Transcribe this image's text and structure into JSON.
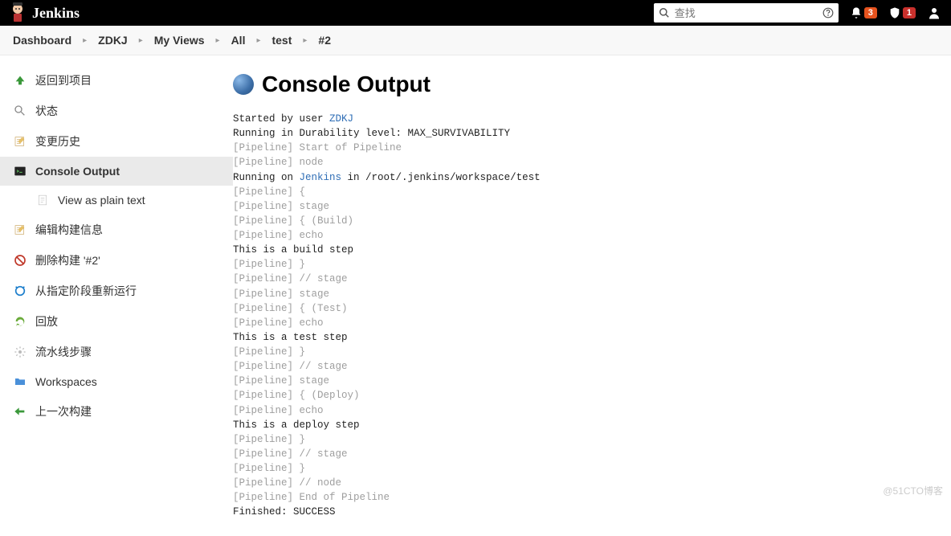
{
  "header": {
    "brand": "Jenkins",
    "search_placeholder": "查找",
    "badge_bell": "3",
    "badge_shield": "1"
  },
  "breadcrumb": [
    "Dashboard",
    "ZDKJ",
    "My Views",
    "All",
    "test",
    "#2"
  ],
  "sidebar": {
    "items": [
      {
        "label": "返回到项目"
      },
      {
        "label": "状态"
      },
      {
        "label": "变更历史"
      },
      {
        "label": "Console Output"
      },
      {
        "label": "View as plain text"
      },
      {
        "label": "编辑构建信息"
      },
      {
        "label": "删除构建 '#2'"
      },
      {
        "label": "从指定阶段重新运行"
      },
      {
        "label": "回放"
      },
      {
        "label": "流水线步骤"
      },
      {
        "label": "Workspaces"
      },
      {
        "label": "上一次构建"
      }
    ]
  },
  "page": {
    "title": "Console Output"
  },
  "console": {
    "lines": [
      {
        "cls": "txt",
        "pre": "Started by user ",
        "link": "ZDKJ",
        "post": ""
      },
      {
        "cls": "txt",
        "text": "Running in Durability level: MAX_SURVIVABILITY"
      },
      {
        "cls": "dim",
        "text": "[Pipeline] Start of Pipeline"
      },
      {
        "cls": "dim",
        "text": "[Pipeline] node"
      },
      {
        "cls": "txt",
        "pre": "Running on ",
        "link": "Jenkins",
        "post": " in /root/.jenkins/workspace/test"
      },
      {
        "cls": "dim",
        "text": "[Pipeline] {"
      },
      {
        "cls": "dim",
        "text": "[Pipeline] stage"
      },
      {
        "cls": "dim",
        "text": "[Pipeline] { (Build)"
      },
      {
        "cls": "dim",
        "text": "[Pipeline] echo"
      },
      {
        "cls": "txt",
        "text": "This is a build step"
      },
      {
        "cls": "dim",
        "text": "[Pipeline] }"
      },
      {
        "cls": "dim",
        "text": "[Pipeline] // stage"
      },
      {
        "cls": "dim",
        "text": "[Pipeline] stage"
      },
      {
        "cls": "dim",
        "text": "[Pipeline] { (Test)"
      },
      {
        "cls": "dim",
        "text": "[Pipeline] echo"
      },
      {
        "cls": "txt",
        "text": "This is a test step"
      },
      {
        "cls": "dim",
        "text": "[Pipeline] }"
      },
      {
        "cls": "dim",
        "text": "[Pipeline] // stage"
      },
      {
        "cls": "dim",
        "text": "[Pipeline] stage"
      },
      {
        "cls": "dim",
        "text": "[Pipeline] { (Deploy)"
      },
      {
        "cls": "dim",
        "text": "[Pipeline] echo"
      },
      {
        "cls": "txt",
        "text": "This is a deploy step"
      },
      {
        "cls": "dim",
        "text": "[Pipeline] }"
      },
      {
        "cls": "dim",
        "text": "[Pipeline] // stage"
      },
      {
        "cls": "dim",
        "text": "[Pipeline] }"
      },
      {
        "cls": "dim",
        "text": "[Pipeline] // node"
      },
      {
        "cls": "dim",
        "text": "[Pipeline] End of Pipeline"
      },
      {
        "cls": "txt",
        "text": "Finished: SUCCESS"
      }
    ]
  },
  "watermark": "@51CTO博客"
}
